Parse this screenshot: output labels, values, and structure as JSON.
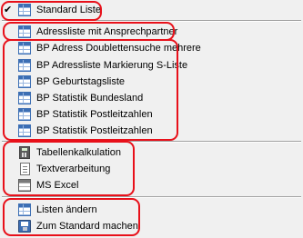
{
  "menu": {
    "standard": {
      "label": "Standard Liste",
      "checked": true,
      "check_glyph": "✔",
      "icon": "table-icon"
    },
    "lists": [
      {
        "label": "Adressliste mit Ansprechpartner",
        "icon": "table-icon"
      },
      {
        "label": "BP Adress Doublettensuche mehrere",
        "icon": "table-icon"
      },
      {
        "label": "BP Adressliste Markierung S-Liste",
        "icon": "table-icon"
      },
      {
        "label": "BP Geburtstagsliste",
        "icon": "table-icon"
      },
      {
        "label": "BP Statistik Bundesland",
        "icon": "table-icon"
      },
      {
        "label": "BP Statistik Postleitzahlen",
        "icon": "table-icon"
      },
      {
        "label": "BP Statistik Postleitzahlen",
        "icon": "table-icon"
      }
    ],
    "export": [
      {
        "label": "Tabellenkalkulation",
        "icon": "calculator-icon"
      },
      {
        "label": "Textverarbeitung",
        "icon": "document-icon"
      },
      {
        "label": "MS Excel",
        "icon": "spreadsheet-icon"
      }
    ],
    "manage": [
      {
        "label": "Listen ändern",
        "icon": "table-icon"
      },
      {
        "label": "Zum Standard machen",
        "icon": "save-icon"
      }
    ]
  },
  "colors": {
    "background": "#f0f0f0",
    "highlight_outline": "#e8101a",
    "icon_blue": "#3d6fb4"
  }
}
